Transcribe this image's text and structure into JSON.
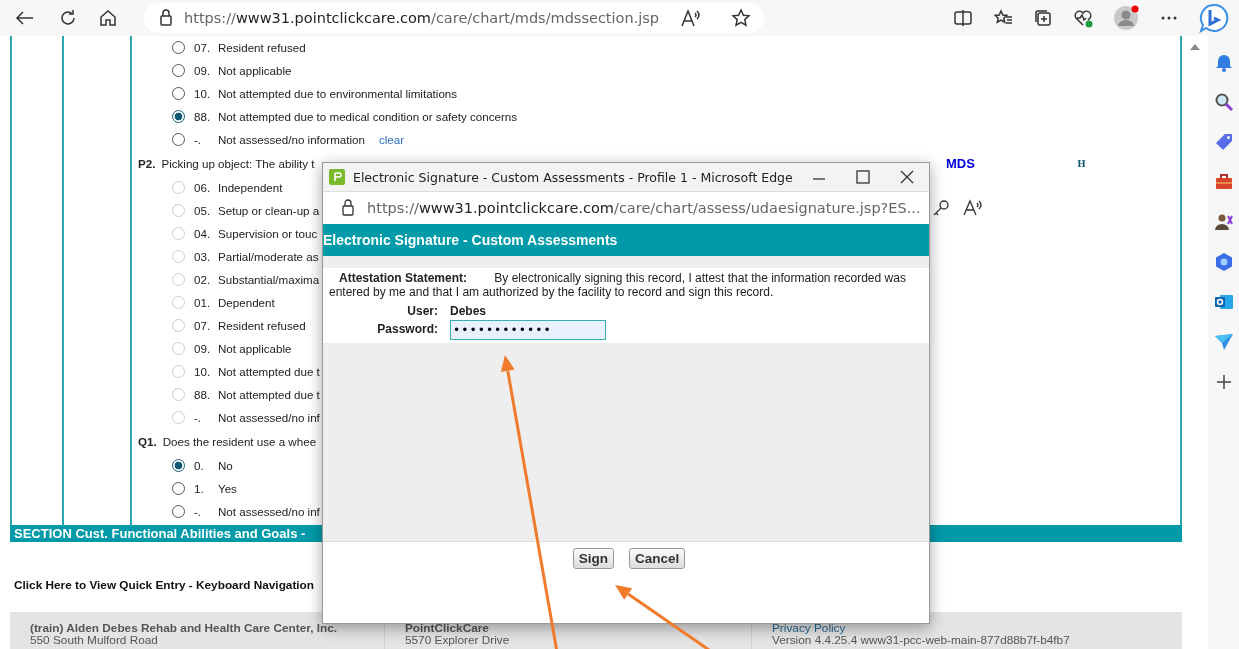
{
  "browser": {
    "url_scheme": "https://",
    "url_host": "www31.pointclickcare.com",
    "url_path": "/care/chart/mds/mdssection.jsp"
  },
  "form": {
    "items": [
      {
        "kind": "option",
        "code": "07.",
        "label": "Resident refused",
        "selected": false,
        "disabled": false
      },
      {
        "kind": "option",
        "code": "09.",
        "label": "Not applicable",
        "selected": false,
        "disabled": false
      },
      {
        "kind": "option",
        "code": "10.",
        "label": "Not attempted due to environmental limitations",
        "selected": false,
        "disabled": false
      },
      {
        "kind": "option",
        "code": "88.",
        "label": "Not attempted due to medical condition or safety concerns",
        "selected": true,
        "disabled": false
      },
      {
        "kind": "option",
        "code": "-.",
        "label": "Not assessed/no information",
        "selected": false,
        "disabled": false,
        "link": "clear"
      },
      {
        "kind": "question",
        "code": "P2.",
        "text": "Picking up object: The ability t",
        "link": "MDS",
        "badge": "H"
      },
      {
        "kind": "option",
        "code": "06.",
        "label": "Independent",
        "selected": false,
        "disabled": true
      },
      {
        "kind": "option",
        "code": "05.",
        "label": "Setup or clean-up a",
        "selected": false,
        "disabled": true
      },
      {
        "kind": "option",
        "code": "04.",
        "label": "Supervision or touc",
        "selected": false,
        "disabled": true
      },
      {
        "kind": "option",
        "code": "03.",
        "label": "Partial/moderate as",
        "selected": false,
        "disabled": true
      },
      {
        "kind": "option",
        "code": "02.",
        "label": "Substantial/maxima",
        "selected": false,
        "disabled": true
      },
      {
        "kind": "option",
        "code": "01.",
        "label": "Dependent",
        "selected": false,
        "disabled": true
      },
      {
        "kind": "option",
        "code": "07.",
        "label": "Resident refused",
        "selected": false,
        "disabled": true
      },
      {
        "kind": "option",
        "code": "09.",
        "label": "Not applicable",
        "selected": false,
        "disabled": true
      },
      {
        "kind": "option",
        "code": "10.",
        "label": "Not attempted due t",
        "selected": false,
        "disabled": true
      },
      {
        "kind": "option",
        "code": "88.",
        "label": "Not attempted due t",
        "selected": false,
        "disabled": true
      },
      {
        "kind": "option",
        "code": "-.",
        "label": "Not assessed/no inf",
        "selected": false,
        "disabled": true
      },
      {
        "kind": "question",
        "code": "Q1.",
        "text": "Does the resident use a whee"
      },
      {
        "kind": "option",
        "code": "0.",
        "label": "No",
        "selected": true,
        "disabled": false
      },
      {
        "kind": "option",
        "code": "1.",
        "label": "Yes",
        "selected": false,
        "disabled": false
      },
      {
        "kind": "option",
        "code": "-.",
        "label": "Not assessed/no inf",
        "selected": false,
        "disabled": false
      }
    ]
  },
  "section_bar": {
    "title": "SECTION Cust. Functional Abilities and Goals -"
  },
  "quick_entry_link": "Click Here to View Quick Entry - Keyboard Navigation",
  "footer": {
    "columns": [
      {
        "kind": "text",
        "heading": "(train) Alden Debes Rehab and Health Care Center, Inc.",
        "line": "550 South Mulford Road"
      },
      {
        "kind": "text",
        "heading": "PointClickCare",
        "line": "5570 Explorer Drive"
      },
      {
        "kind": "link",
        "heading": "Privacy Policy",
        "line": "Version 4.4.25.4 www31-pcc-web-main-877d88b7f-b4fb7"
      }
    ]
  },
  "popup": {
    "title": "Electronic Signature - Custom Assessments - Profile 1 - Microsoft Edge",
    "url_scheme": "https://",
    "url_host": "www31.pointclickcare.com",
    "url_path": "/care/chart/assess/udaesignature.jsp?ES...",
    "heading": "Electronic Signature - Custom Assessments",
    "attestation": "**Attestation Statement:**      By electronically signing this record, I attest that the information recorded was entered by me and that I am authorized by the facility to record and sign this record.",
    "user_label": "User:",
    "user": "Debes",
    "password_label": "Password:",
    "password": "••••••••••••",
    "buttons": [
      "Sign",
      "Cancel"
    ]
  }
}
